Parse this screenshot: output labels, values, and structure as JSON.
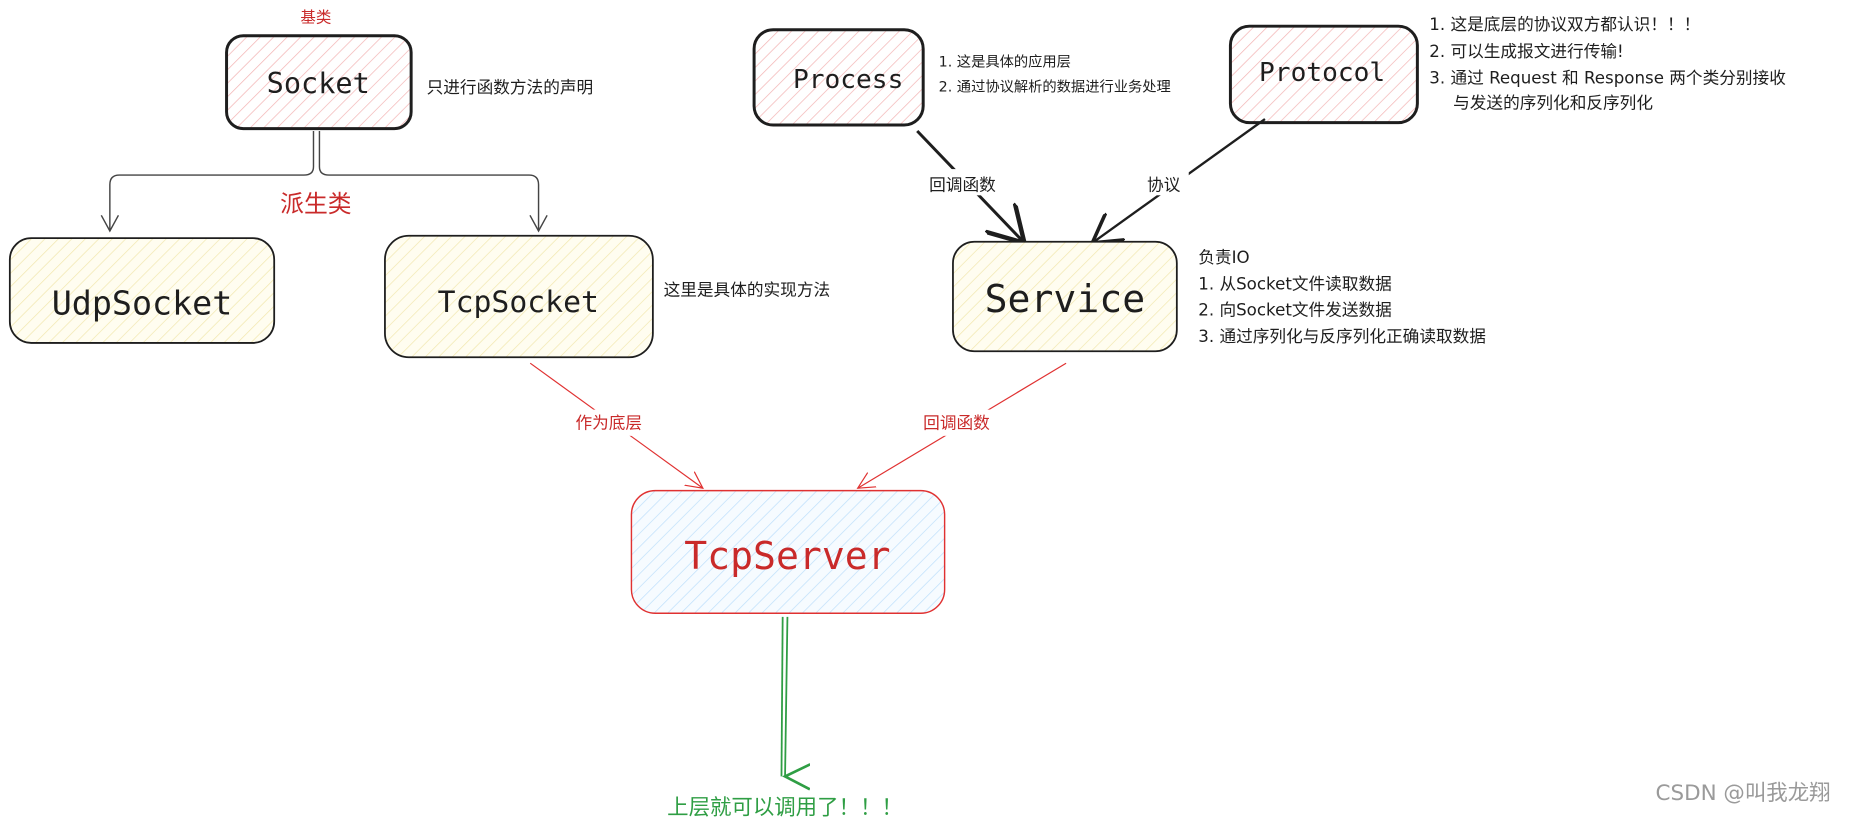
{
  "colors": {
    "pink_fill": "#ffc9c9",
    "yellow_fill": "#fff3bf",
    "blue_fill": "#a5d8ff",
    "red": "#c92a2a",
    "green": "#2f9e44",
    "ink": "#1e1e1e",
    "watermark": "#9a9a9a"
  },
  "socket": {
    "tag": "基类",
    "label": "Socket",
    "note": "只进行函数方法的声明"
  },
  "derived_label": "派生类",
  "udp": {
    "label": "UdpSocket"
  },
  "tcp": {
    "label": "TcpSocket",
    "note": "这里是具体的实现方法"
  },
  "process": {
    "label": "Process",
    "notes": [
      "1.  这是具体的应用层",
      "2. 通过协议解析的数据进行业务处理"
    ]
  },
  "protocol": {
    "label": "Protocol",
    "notes": [
      "1. 这是底层的协议双方都认识！！！",
      "2. 可以生成报文进行传输!",
      "3. 通过 Request 和 Response 两个类分别接收",
      "与发送的序列化和反序列化"
    ]
  },
  "service": {
    "label": "Service",
    "notes": [
      "负责IO",
      "1.  从Socket文件读取数据",
      "2. 向Socket文件发送数据",
      "3. 通过序列化与反序列化正确读取数据"
    ]
  },
  "edges": {
    "process_to_service": "回调函数",
    "protocol_to_service": "协议",
    "tcp_to_server": "作为底层",
    "service_to_server": "回调函数"
  },
  "server": {
    "label": "TcpServer"
  },
  "bottom_label": "上层就可以调用了！！！",
  "watermark": "CSDN @叫我龙翔"
}
